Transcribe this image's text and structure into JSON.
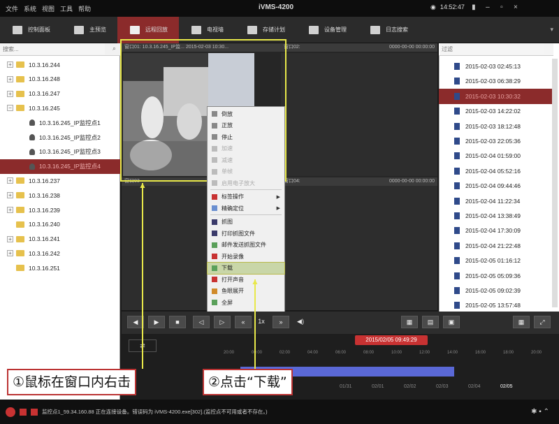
{
  "menubar": {
    "items": [
      "文件",
      "系统",
      "视图",
      "工具",
      "帮助"
    ]
  },
  "app_title": "iVMS-4200",
  "clock": "14:52:47",
  "tabs": [
    {
      "label": "控制面板",
      "active": false
    },
    {
      "label": "主预览",
      "active": false
    },
    {
      "label": "远程回放",
      "active": true
    },
    {
      "label": "电视墙",
      "active": false
    },
    {
      "label": "存储计划",
      "active": false
    },
    {
      "label": "设备管理",
      "active": false
    },
    {
      "label": "日志搜索",
      "active": false
    }
  ],
  "left_search": {
    "placeholder": "搜索..."
  },
  "tree": [
    {
      "label": "10.3.16.244",
      "type": "folder",
      "exp": "+",
      "selected": false
    },
    {
      "label": "10.3.16.248",
      "type": "folder",
      "exp": "+",
      "selected": false
    },
    {
      "label": "10.3.16.247",
      "type": "folder",
      "exp": "+",
      "selected": false
    },
    {
      "label": "10.3.16.245",
      "type": "folder",
      "exp": "−",
      "selected": false
    },
    {
      "label": "10.3.16.245_IP监控点1",
      "type": "camera",
      "selected": false
    },
    {
      "label": "10.3.16.245_IP监控点2",
      "type": "camera",
      "selected": false
    },
    {
      "label": "10.3.16.245_IP监控点3",
      "type": "camera",
      "selected": false
    },
    {
      "label": "10.3.16.245_IP监控点4",
      "type": "camera",
      "selected": true
    },
    {
      "label": "10.3.16.237",
      "type": "folder",
      "exp": "+",
      "selected": false
    },
    {
      "label": "10.3.16.238",
      "type": "folder",
      "exp": "+",
      "selected": false
    },
    {
      "label": "10.3.16.239",
      "type": "folder",
      "exp": "+",
      "selected": false
    },
    {
      "label": "10.3.16.240",
      "type": "folder",
      "exp": "",
      "selected": false
    },
    {
      "label": "10.3.16.241",
      "type": "folder",
      "exp": "+",
      "selected": false
    },
    {
      "label": "10.3.16.242",
      "type": "folder",
      "exp": "+",
      "selected": false
    },
    {
      "label": "10.3.16.251",
      "type": "folder",
      "exp": "",
      "selected": false
    }
  ],
  "panes": {
    "p1": "窗口01:  10.3.16.245_IP监...  2015-02-03 10:30...",
    "p2": "窗口02:",
    "p2_time": "0000-00-00 00:00:00",
    "p3": "窗口03",
    "p4": "窗口04:",
    "p4_time": "0000-00-00 00:00:00"
  },
  "context_menu": [
    {
      "label": "倒放",
      "disabled": false,
      "arrow": false
    },
    {
      "label": "正放",
      "disabled": false,
      "arrow": false
    },
    {
      "label": "停止",
      "disabled": false,
      "arrow": false
    },
    {
      "label": "加速",
      "disabled": true,
      "arrow": false
    },
    {
      "label": "减速",
      "disabled": true,
      "arrow": false
    },
    {
      "label": "单帧",
      "disabled": true,
      "arrow": false
    },
    {
      "label": "启用电子放大",
      "disabled": true,
      "arrow": false
    },
    {
      "label": "标签操作",
      "disabled": false,
      "arrow": true
    },
    {
      "label": "精确定位",
      "disabled": false,
      "arrow": true
    },
    {
      "label": "抓图",
      "disabled": false,
      "arrow": false
    },
    {
      "label": "打印抓图文件",
      "disabled": false,
      "arrow": false
    },
    {
      "label": "邮件发送抓图文件",
      "disabled": false,
      "arrow": false
    },
    {
      "label": "开始录像",
      "disabled": false,
      "arrow": false
    },
    {
      "label": "下载",
      "disabled": false,
      "arrow": false,
      "highlight": true
    },
    {
      "label": "打开声音",
      "disabled": false,
      "arrow": false
    },
    {
      "label": "鱼眼展开",
      "disabled": false,
      "arrow": false
    },
    {
      "label": "全屏",
      "disabled": false,
      "arrow": false
    }
  ],
  "right_search": {
    "placeholder": "过滤"
  },
  "records": [
    {
      "label": "2015-02-03 02:45:13",
      "selected": false
    },
    {
      "label": "2015-02-03 06:38:29",
      "selected": false
    },
    {
      "label": "2015-02-03 10:30:32",
      "selected": true
    },
    {
      "label": "2015-02-03 14:22:02",
      "selected": false
    },
    {
      "label": "2015-02-03 18:12:48",
      "selected": false
    },
    {
      "label": "2015-02-03 22:05:36",
      "selected": false
    },
    {
      "label": "2015-02-04 01:59:00",
      "selected": false
    },
    {
      "label": "2015-02-04 05:52:16",
      "selected": false
    },
    {
      "label": "2015-02-04 09:44:46",
      "selected": false
    },
    {
      "label": "2015-02-04 11:22:34",
      "selected": false
    },
    {
      "label": "2015-02-04 13:38:49",
      "selected": false
    },
    {
      "label": "2015-02-04 17:30:09",
      "selected": false
    },
    {
      "label": "2015-02-04 21:22:48",
      "selected": false
    },
    {
      "label": "2015-02-05 01:16:12",
      "selected": false
    },
    {
      "label": "2015-02-05 05:09:36",
      "selected": false
    },
    {
      "label": "2015-02-05 09:02:39",
      "selected": false
    },
    {
      "label": "2015-02-05 13:57:48",
      "selected": false
    }
  ],
  "speed": "1x",
  "timeline": {
    "date_badge": "2015/02/05 09:49:29",
    "ruler_ticks": [
      "20:00",
      "00:00",
      "02:00",
      "04:00",
      "06:00",
      "08:00",
      "10:00",
      "12:00",
      "14:00",
      "16:00",
      "18:00",
      "20:00"
    ],
    "dates": [
      "01/31",
      "02/01",
      "02/02",
      "02/03",
      "02/04",
      "02/05"
    ]
  },
  "captions": {
    "c1": "①鼠标在窗口内右击",
    "c2": "②点击“下载”"
  },
  "status_text": "监控点1_59.34.160.88 正在连接设备。错误码为 iVMS-4200.exe[302].(监控点不可用或者不存在。)",
  "colors": {
    "accent": "#8b2b2b",
    "highlight": "#e8e84a",
    "timeline_bar": "#5a68d6"
  }
}
